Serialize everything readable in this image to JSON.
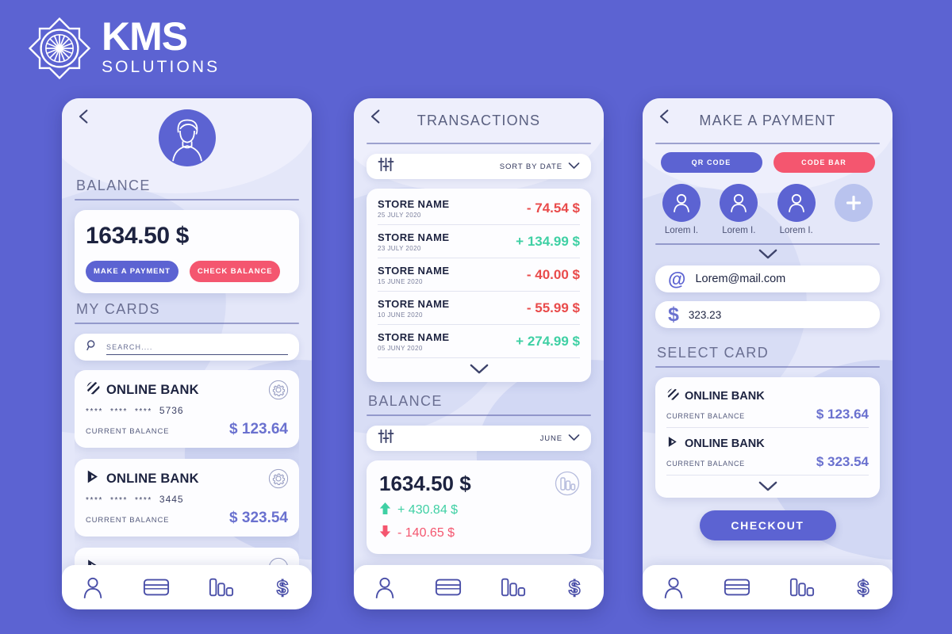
{
  "brand": {
    "name": "KMS",
    "tagline": "SOLUTIONS",
    "mark_icon": "kms-starburst-logo",
    "color": "#ffffff"
  },
  "theme": {
    "background": "#5c63d2",
    "phone_bg": "#e4e7f9",
    "accent_blue": "#5c63d2",
    "accent_red": "#f4566f",
    "positive_green": "#3fd0a4",
    "negative_red": "#e94b4b",
    "amount_violet": "#6a71cf",
    "dark_text": "#1d2340"
  },
  "screen1": {
    "back_icon": "chevron-left-icon",
    "avatar_icon": "user-avatar-icon",
    "balance_label": "BALANCE",
    "balance_amount": "1634.50 $",
    "make_payment_label": "MAKE A PAYMENT",
    "check_balance_label": "CHECK BALANCE",
    "my_cards_label": "MY CARDS",
    "search": {
      "icon": "search-icon",
      "placeholder": "SEARCH...."
    },
    "cards": [
      {
        "logo_icon": "striped-circle-bank-logo",
        "name": "ONLINE BANK",
        "masked_groups": [
          "****",
          "****",
          "****"
        ],
        "last4": "5736",
        "balance_label": "CURRENT BALANCE",
        "balance": "$  123.64",
        "settings_icon": "gear-icon"
      },
      {
        "logo_icon": "triangle-play-bank-logo",
        "name": "ONLINE BANK",
        "masked_groups": [
          "****",
          "****",
          "****"
        ],
        "last4": "3445",
        "balance_label": "CURRENT BALANCE",
        "balance": "$  323.54",
        "settings_icon": "gear-icon"
      }
    ]
  },
  "screen2": {
    "back_icon": "chevron-left-icon",
    "title": "TRANSACTIONS",
    "filter": {
      "filter_icon": "sliders-filter-icon",
      "sort_label": "SORT BY DATE",
      "chevron_icon": "chevron-down-icon"
    },
    "transactions": [
      {
        "store": "STORE NAME",
        "date": "25 JULY 2020",
        "amount": "- 74.54 $",
        "sign": "neg"
      },
      {
        "store": "STORE NAME",
        "date": "23 JULY 2020",
        "amount": "+ 134.99 $",
        "sign": "pos"
      },
      {
        "store": "STORE NAME",
        "date": "15 JUNE 2020",
        "amount": "- 40.00 $",
        "sign": "neg"
      },
      {
        "store": "STORE NAME",
        "date": "10 JUNE 2020",
        "amount": "- 55.99 $",
        "sign": "neg"
      },
      {
        "store": "STORE NAME",
        "date": "05 JUNY 2020",
        "amount": "+ 274.99 $",
        "sign": "pos"
      }
    ],
    "expand_icon": "chevron-down-icon",
    "balance_label": "BALANCE",
    "month_filter": {
      "filter_icon": "sliders-filter-icon",
      "month_label": "JUNE",
      "chevron_icon": "chevron-down-icon"
    },
    "summary": {
      "total": "1634.50 $",
      "income": "+ 430.84 $",
      "income_icon": "arrow-up-icon",
      "expense": "- 140.65 $",
      "expense_icon": "arrow-down-icon",
      "chart_icon": "bar-chart-circle-icon"
    }
  },
  "screen3": {
    "back_icon": "chevron-left-icon",
    "title": "MAKE A PAYMENT",
    "qr_code_label": "QR CODE",
    "code_bar_label": "CODE BAR",
    "contacts": [
      {
        "name": "Lorem I.",
        "icon": "user-avatar-icon"
      },
      {
        "name": "Lorem I.",
        "icon": "user-avatar-icon"
      },
      {
        "name": "Lorem I.",
        "icon": "user-avatar-icon"
      }
    ],
    "add_contact_icon": "plus-icon",
    "expand_icon": "chevron-down-icon",
    "email_field": {
      "icon": "at-sign-icon",
      "value": "Lorem@mail.com"
    },
    "amount_field": {
      "icon": "dollar-sign-icon",
      "value": "323.23"
    },
    "select_card_label": "SELECT CARD",
    "cards": [
      {
        "logo_icon": "striped-circle-bank-logo",
        "name": "ONLINE BANK",
        "balance_label": "CURRENT BALANCE",
        "balance": "$  123.64"
      },
      {
        "logo_icon": "triangle-play-bank-logo",
        "name": "ONLINE BANK",
        "balance_label": "CURRENT BALANCE",
        "balance": "$  323.54"
      }
    ],
    "cards_expand_icon": "chevron-down-icon",
    "checkout_label": "CHECKOUT"
  },
  "bottom_nav": {
    "items": [
      {
        "icon": "person-icon"
      },
      {
        "icon": "credit-card-icon"
      },
      {
        "icon": "bar-chart-icon"
      },
      {
        "icon": "dollar-icon"
      }
    ]
  }
}
